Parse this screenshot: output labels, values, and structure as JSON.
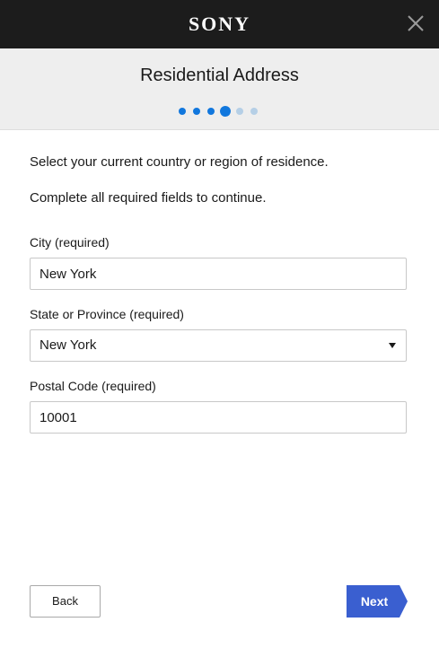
{
  "brand": {
    "logo_text": "SONY"
  },
  "icons": {
    "close": "close-icon",
    "dropdown": "chevron-down-icon"
  },
  "colors": {
    "topbar": "#1c1c1c",
    "accent": "#3a5fd0",
    "dot_active": "#1177dd",
    "dot_inactive": "#b5cfe6"
  },
  "header": {
    "title": "Residential Address",
    "progress": {
      "total_steps": 6,
      "current_step": 4
    }
  },
  "intro": {
    "line1": "Select your current country or region of residence.",
    "line2": "Complete all required fields to continue."
  },
  "form": {
    "city": {
      "label": "City (required)",
      "value": "New York"
    },
    "state": {
      "label": "State or Province (required)",
      "value": "New York"
    },
    "postal": {
      "label": "Postal Code (required)",
      "value": "10001"
    }
  },
  "footer": {
    "back_label": "Back",
    "next_label": "Next"
  }
}
